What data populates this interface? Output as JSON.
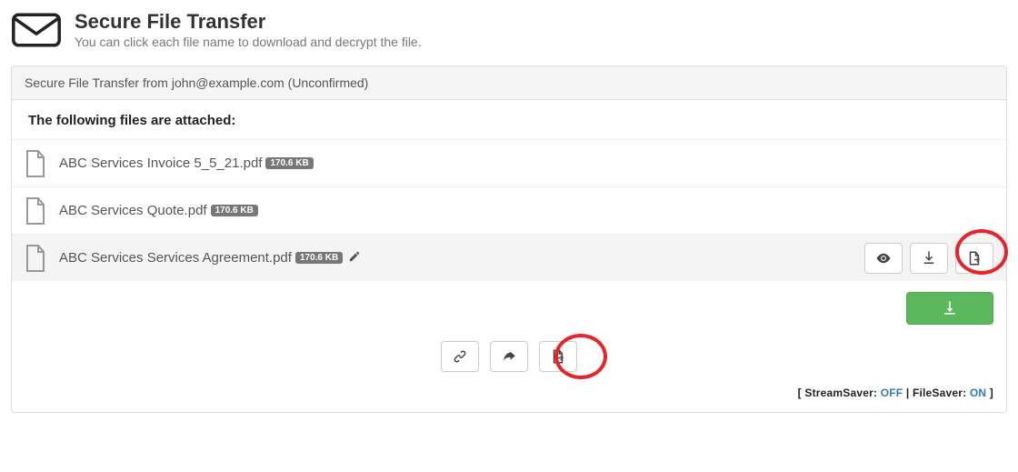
{
  "header": {
    "title": "Secure File Transfer",
    "subtitle": "You can click each file name to download and decrypt the file."
  },
  "panel": {
    "from_line": "Secure File Transfer from john@example.com (Unconfirmed)",
    "attached_title": "The following files are attached:"
  },
  "files": [
    {
      "name": "ABC Services Invoice 5_5_21.pdf",
      "size": "170.6 KB"
    },
    {
      "name": "ABC Services Quote.pdf",
      "size": "170.6 KB"
    },
    {
      "name": "ABC Services Services Agreement.pdf",
      "size": "170.6 KB"
    }
  ],
  "status": {
    "prefix": "[ StreamSaver: ",
    "stream": "OFF",
    "mid": " | FileSaver: ",
    "file": "ON",
    "suffix": " ]"
  }
}
